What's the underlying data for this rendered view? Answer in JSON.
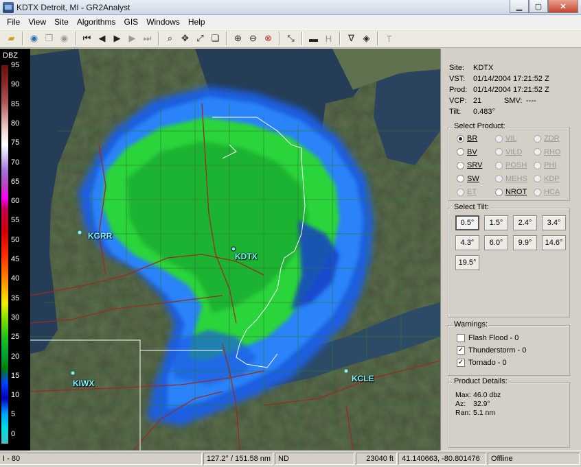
{
  "window": {
    "title": "KDTX Detroit, MI - GR2Analyst"
  },
  "menu": [
    "File",
    "View",
    "Site",
    "Algorithms",
    "GIS",
    "Windows",
    "Help"
  ],
  "toolbar_icons": [
    {
      "name": "open-icon",
      "glyph": "📂"
    },
    {
      "name": "globe-icon",
      "glyph": "◉"
    },
    {
      "name": "copy-icon",
      "glyph": "❐"
    },
    {
      "name": "dim-globe-icon",
      "glyph": "◉"
    },
    {
      "name": "skip-back-icon",
      "glyph": "⏮"
    },
    {
      "name": "step-back-icon",
      "glyph": "◀"
    },
    {
      "name": "play-icon",
      "glyph": "▶"
    },
    {
      "name": "step-forward-icon",
      "glyph": "▶"
    },
    {
      "name": "skip-forward-icon",
      "glyph": "⏭"
    },
    {
      "name": "zoom-icon",
      "glyph": "🔍"
    },
    {
      "name": "pan-icon",
      "glyph": "✥"
    },
    {
      "name": "measure-icon",
      "glyph": "⤢"
    },
    {
      "name": "layers-icon",
      "glyph": "❏"
    },
    {
      "name": "zoom-in-icon",
      "glyph": "⊕"
    },
    {
      "name": "zoom-out-icon",
      "glyph": "⊖"
    },
    {
      "name": "zoom-reset-icon",
      "glyph": "⊗"
    },
    {
      "name": "link-icon",
      "glyph": "⤡"
    },
    {
      "name": "bar-icon",
      "glyph": "▬"
    },
    {
      "name": "h-icon",
      "glyph": "H"
    },
    {
      "name": "filter-icon",
      "glyph": "∇"
    },
    {
      "name": "diamond-icon",
      "glyph": "◈"
    },
    {
      "name": "text-icon",
      "glyph": "T"
    }
  ],
  "scale": {
    "title": "DBZ",
    "labels": [
      "95",
      "90",
      "85",
      "80",
      "75",
      "70",
      "65",
      "60",
      "55",
      "50",
      "45",
      "40",
      "35",
      "30",
      "25",
      "20",
      "15",
      "10",
      "5",
      "0"
    ]
  },
  "map": {
    "sites": [
      {
        "id": "kgrr",
        "label": "KGRR"
      },
      {
        "id": "kdtx",
        "label": "KDTX"
      },
      {
        "id": "kiwx",
        "label": "KIWX"
      },
      {
        "id": "kcle",
        "label": "KCLE"
      }
    ]
  },
  "info": {
    "site_key": "Site:",
    "site": "KDTX",
    "vst_key": "VST:",
    "vst": "01/14/2004  17:21:52 Z",
    "prod_key": "Prod:",
    "prod": "01/14/2004  17:21:52 Z",
    "vcp_key": "VCP:",
    "vcp": "21",
    "smv_key": "SMV:",
    "smv": "----",
    "tilt_key": "Tilt:",
    "tilt": "0.483°"
  },
  "select_product": {
    "title": "Select Product:",
    "options": [
      {
        "label": "BR",
        "selected": true,
        "enabled": true
      },
      {
        "label": "VIL",
        "selected": false,
        "enabled": false
      },
      {
        "label": "ZDR",
        "selected": false,
        "enabled": false
      },
      {
        "label": "BV",
        "selected": false,
        "enabled": true
      },
      {
        "label": "VILD",
        "selected": false,
        "enabled": false
      },
      {
        "label": "RHO",
        "selected": false,
        "enabled": false
      },
      {
        "label": "SRV",
        "selected": false,
        "enabled": true
      },
      {
        "label": "POSH",
        "selected": false,
        "enabled": false
      },
      {
        "label": "PHI",
        "selected": false,
        "enabled": false
      },
      {
        "label": "SW",
        "selected": false,
        "enabled": true
      },
      {
        "label": "MEHS",
        "selected": false,
        "enabled": false
      },
      {
        "label": "KDP",
        "selected": false,
        "enabled": false
      },
      {
        "label": "ET",
        "selected": false,
        "enabled": false
      },
      {
        "label": "NROT",
        "selected": false,
        "enabled": true
      },
      {
        "label": "HCA",
        "selected": false,
        "enabled": false
      }
    ]
  },
  "select_tilt": {
    "title": "Select Tilt:",
    "buttons": [
      "0.5°",
      "1.5°",
      "2.4°",
      "3.4°",
      "4.3°",
      "6.0°",
      "9.9°",
      "14.6°",
      "19.5°"
    ],
    "active": "0.5°"
  },
  "warnings": {
    "title": "Warnings:",
    "items": [
      {
        "label": "Flash Flood - 0",
        "checked": false
      },
      {
        "label": "Thunderstorm - 0",
        "checked": true
      },
      {
        "label": "Tornado - 0",
        "checked": true
      }
    ]
  },
  "product_details": {
    "title": "Product Details:",
    "max_key": "Max:",
    "max": "46.0 dbz",
    "az_key": "Az:",
    "az": "32.9°",
    "ran_key": "Ran:",
    "ran": "5.1 nm"
  },
  "status": {
    "frame": "I - 80",
    "az_range": "127.2° / 151.58 nm",
    "nd": "ND",
    "height": "23040 ft",
    "coords": "41.140663, -80.801476",
    "conn": "Offline"
  }
}
